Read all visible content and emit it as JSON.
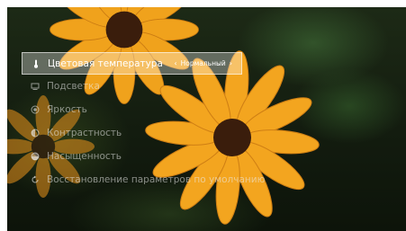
{
  "menu": {
    "items": [
      {
        "label": "Цветовая температура",
        "icon": "thermometer-icon",
        "value": "Нормальный",
        "selected": true
      },
      {
        "label": "Подсветка",
        "icon": "backlight-icon"
      },
      {
        "label": "Яркость",
        "icon": "brightness-icon"
      },
      {
        "label": "Контрастность",
        "icon": "contrast-icon"
      },
      {
        "label": "Насыщенность",
        "icon": "saturation-icon"
      },
      {
        "label": "Восстановление параметров по умолчанию",
        "icon": "reset-icon"
      }
    ],
    "prev_symbol": "‹",
    "next_symbol": "›"
  },
  "colors": {
    "petal": "#f2a31a",
    "petal_dark": "#d9801a",
    "center": "#3a1d0c"
  }
}
